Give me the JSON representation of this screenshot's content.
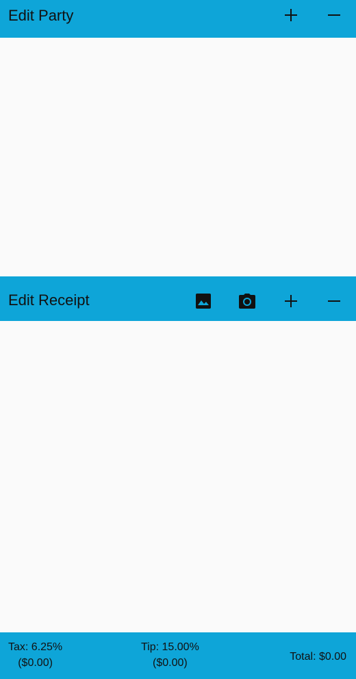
{
  "party": {
    "title": "Edit Party"
  },
  "receipt": {
    "title": "Edit Receipt"
  },
  "summary": {
    "tax_label": "Tax: 6.25%",
    "tax_amount": "($0.00)",
    "tip_label": "Tip: 15.00%",
    "tip_amount": "($0.00)",
    "total": "Total: $0.00"
  },
  "icons": {
    "add": "plus-icon",
    "remove": "minus-icon",
    "gallery": "image-icon",
    "camera": "camera-icon"
  },
  "colors": {
    "accent": "#0ea5d8",
    "background": "#fafafa",
    "text": "#111111"
  }
}
